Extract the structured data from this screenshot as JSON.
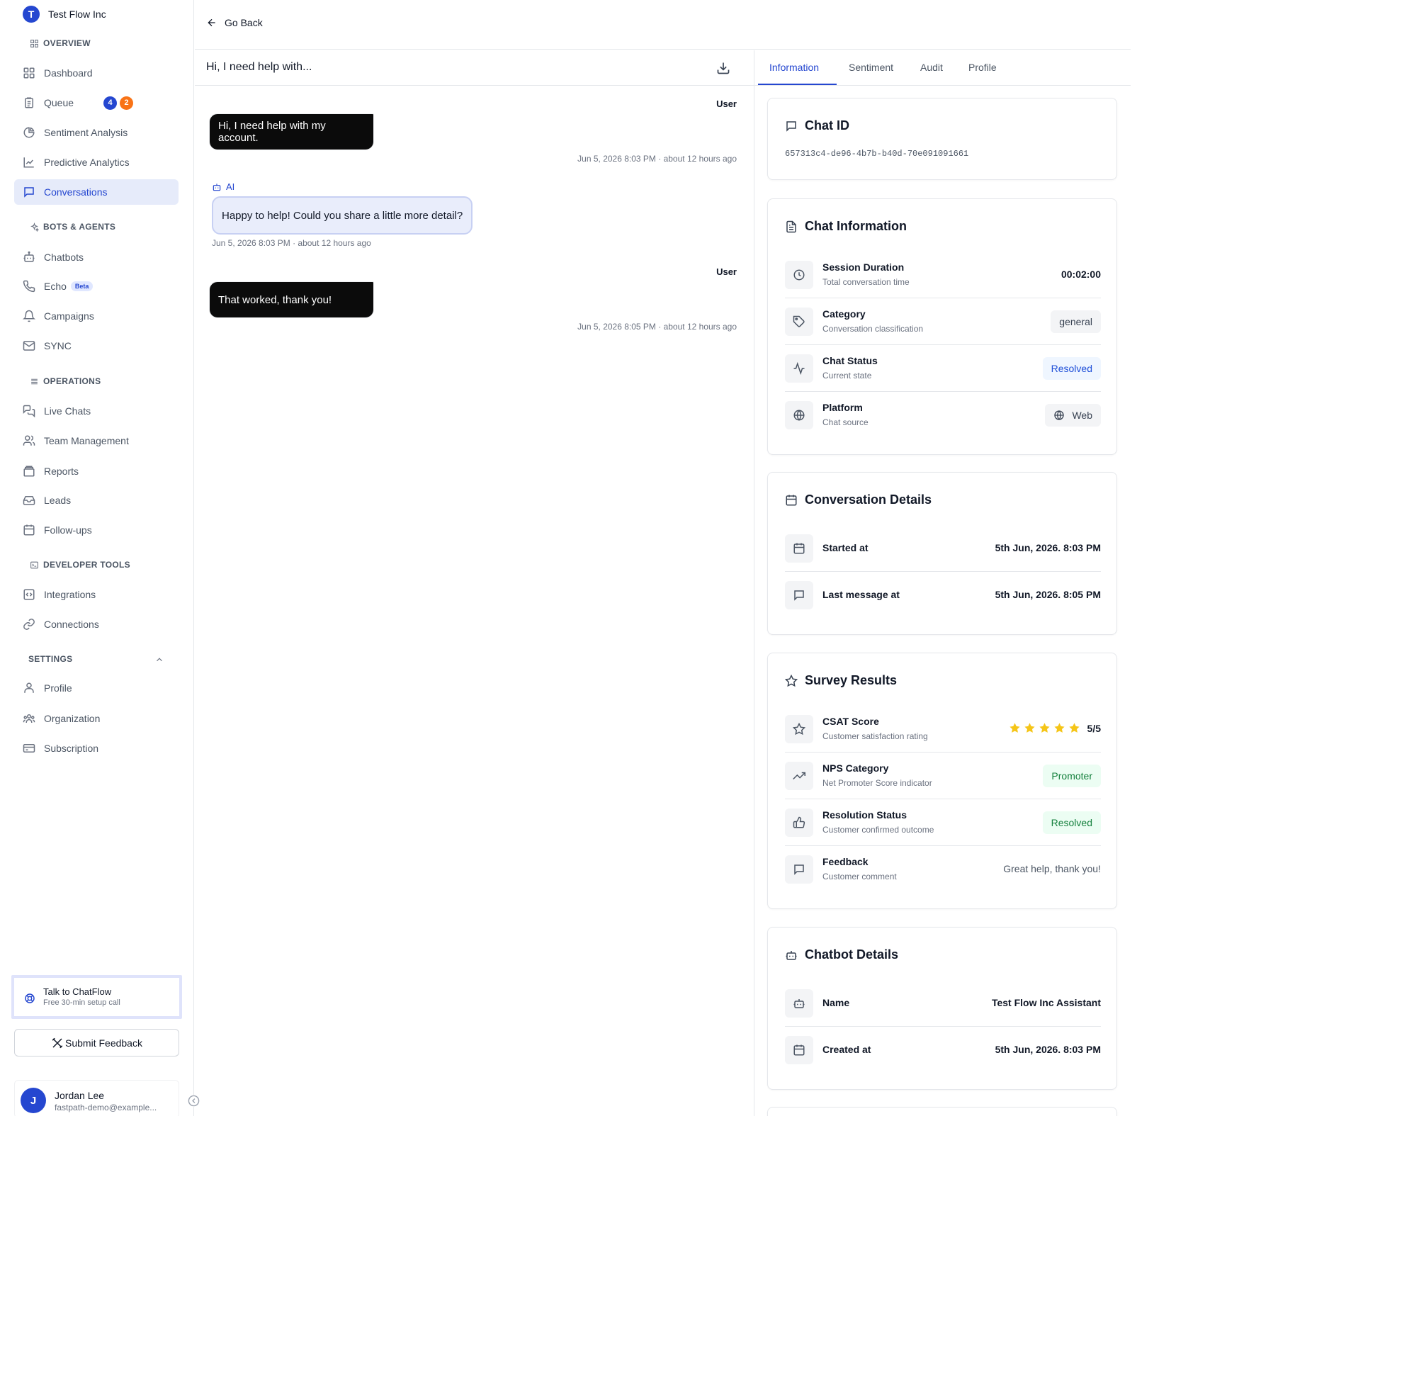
{
  "org": {
    "initial": "T",
    "name": "Test Flow Inc"
  },
  "colors": {
    "brand": "#2547d0",
    "queue_badge_orange": "#f97316",
    "star": "#f5c518"
  },
  "sidebar": {
    "overview_label": "OVERVIEW",
    "bots_label": "BOTS & AGENTS",
    "operations_label": "OPERATIONS",
    "developer_label": "DEVELOPER TOOLS",
    "settings_label": "SETTINGS",
    "items": {
      "dashboard": "Dashboard",
      "queue": "Queue",
      "queue_badge_blue": "4",
      "queue_badge_orange": "2",
      "sentiment": "Sentiment Analysis",
      "predictive": "Predictive Analytics",
      "conversations": "Conversations",
      "chatbots": "Chatbots",
      "echo": "Echo",
      "echo_badge": "Beta",
      "campaigns": "Campaigns",
      "sync": "SYNC",
      "live_chats": "Live Chats",
      "team": "Team Management",
      "reports": "Reports",
      "leads": "Leads",
      "followups": "Follow-ups",
      "integrations": "Integrations",
      "connections": "Connections",
      "profile": "Profile",
      "organization": "Organization",
      "subscription": "Subscription"
    },
    "talk": {
      "title": "Talk to ChatFlow",
      "subtitle": "Free 30-min setup call"
    },
    "feedback_label": "Submit Feedback",
    "user": {
      "initial": "J",
      "name": "Jordan Lee",
      "email": "fastpath-demo@example..."
    }
  },
  "header": {
    "go_back": "Go Back"
  },
  "chat": {
    "title": "Hi, I need help with...",
    "messages": [
      {
        "sender": "User",
        "text": "Hi, I need help with my account.",
        "time": "Jun 5, 2026 8:03 PM · about 12 hours ago"
      },
      {
        "sender": "AI",
        "text": "Happy to help! Could you share a little more detail?",
        "time": "Jun 5, 2026 8:03 PM · about 12 hours ago"
      },
      {
        "sender": "User",
        "text": "That worked, thank you!",
        "time": "Jun 5, 2026 8:05 PM · about 12 hours ago"
      }
    ]
  },
  "panel": {
    "tabs": [
      "Information",
      "Sentiment",
      "Audit",
      "Profile"
    ],
    "chat_id": {
      "title": "Chat ID",
      "value": "657313c4-de96-4b7b-b40d-70e091091661"
    },
    "chat_info": {
      "title": "Chat Information",
      "session": {
        "label": "Session Duration",
        "sub": "Total conversation time",
        "value": "00:02:00"
      },
      "category": {
        "label": "Category",
        "sub": "Conversation classification",
        "value": "general"
      },
      "status": {
        "label": "Chat Status",
        "sub": "Current state",
        "value": "Resolved"
      },
      "platform": {
        "label": "Platform",
        "sub": "Chat source",
        "value": "Web"
      }
    },
    "conversation": {
      "title": "Conversation Details",
      "started": {
        "label": "Started at",
        "value": "5th Jun, 2026. 8:03 PM"
      },
      "last": {
        "label": "Last message at",
        "value": "5th Jun, 2026. 8:05 PM"
      }
    },
    "survey": {
      "title": "Survey Results",
      "csat": {
        "label": "CSAT Score",
        "sub": "Customer satisfaction rating",
        "stars": 5,
        "value": "5/5"
      },
      "nps": {
        "label": "NPS Category",
        "sub": "Net Promoter Score indicator",
        "value": "Promoter"
      },
      "resolution": {
        "label": "Resolution Status",
        "sub": "Customer confirmed outcome",
        "value": "Resolved"
      },
      "feedback": {
        "label": "Feedback",
        "sub": "Customer comment",
        "value": "Great help, thank you!"
      }
    },
    "chatbot": {
      "title": "Chatbot Details",
      "name": {
        "label": "Name",
        "value": "Test Flow Inc Assistant"
      },
      "created": {
        "label": "Created at",
        "value": "5th Jun, 2026. 8:03 PM"
      }
    }
  }
}
